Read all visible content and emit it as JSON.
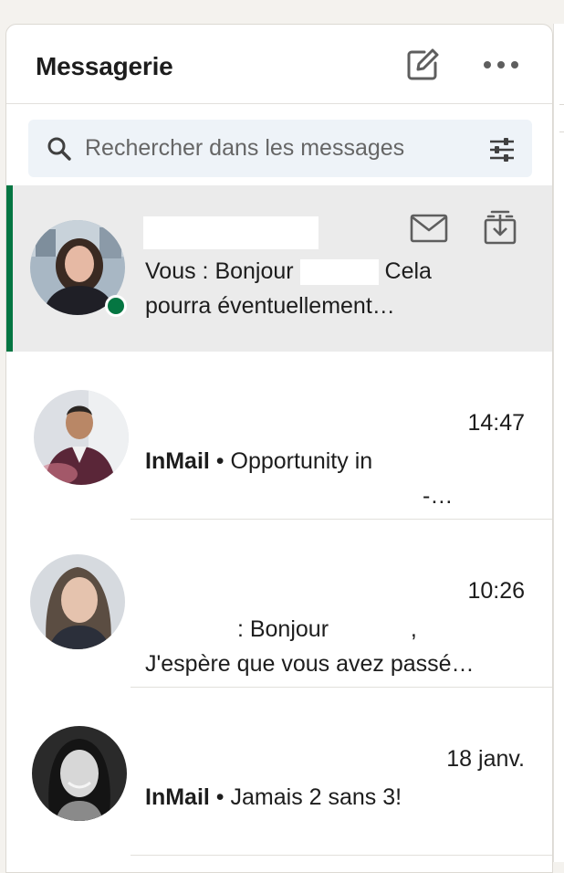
{
  "header": {
    "title": "Messagerie",
    "compose_icon": "compose-icon",
    "more_icon": "more-horizontal-icon"
  },
  "search": {
    "placeholder": "Rechercher dans les messages",
    "search_icon": "search-icon",
    "filter_icon": "filter-sliders-icon"
  },
  "colors": {
    "active_bar": "#057642",
    "presence": "#057642",
    "active_row_bg": "#ebebeb",
    "search_bg": "#eef3f8"
  },
  "conversations": [
    {
      "selected": true,
      "online": true,
      "preview_prefix": "Vous : Bonjour",
      "preview_after_redaction": "Cela",
      "preview_line2": "pourra éventuellement…",
      "actions": [
        "mail-icon",
        "archive-icon"
      ]
    },
    {
      "time": "14:47",
      "label": "InMail",
      "separator": "•",
      "preview_line1": "Opportunity in",
      "preview_line2_tail": "-…"
    },
    {
      "time": "10:26",
      "preview_line1": ": Bonjour",
      "preview_line1_tail": ",",
      "preview_line2": "J'espère que vous avez passé…"
    },
    {
      "time": "18 janv.",
      "label": "InMail",
      "separator": "•",
      "preview_line1": "Jamais 2 sans 3!"
    }
  ]
}
